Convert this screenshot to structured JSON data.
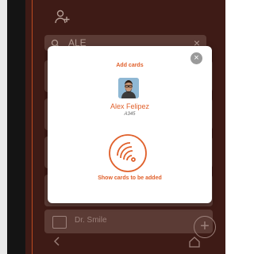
{
  "search": {
    "value": "ALE"
  },
  "background_list": {
    "visible_item_name": "Dr. Smile"
  },
  "modal": {
    "title": "Add cards",
    "user": {
      "name": "Alex Felipez",
      "code": "A345"
    },
    "show_cards_label": "Show cards to be added",
    "close_label": "×"
  },
  "icons": {
    "top": "add-user-icon",
    "search": "search-icon",
    "search_clear": "close-icon",
    "nfc": "nfc-card-icon",
    "modal_close": "close-icon",
    "nav_back": "back-chevron-icon",
    "nav_home": "home-icon",
    "row": "card-icon",
    "add": "plus-icon"
  },
  "colors": {
    "accent": "#e0602b",
    "overlay_bg": "#3e1b16",
    "modal_bg": "#ffffff",
    "muted": "#9a9a9a"
  }
}
